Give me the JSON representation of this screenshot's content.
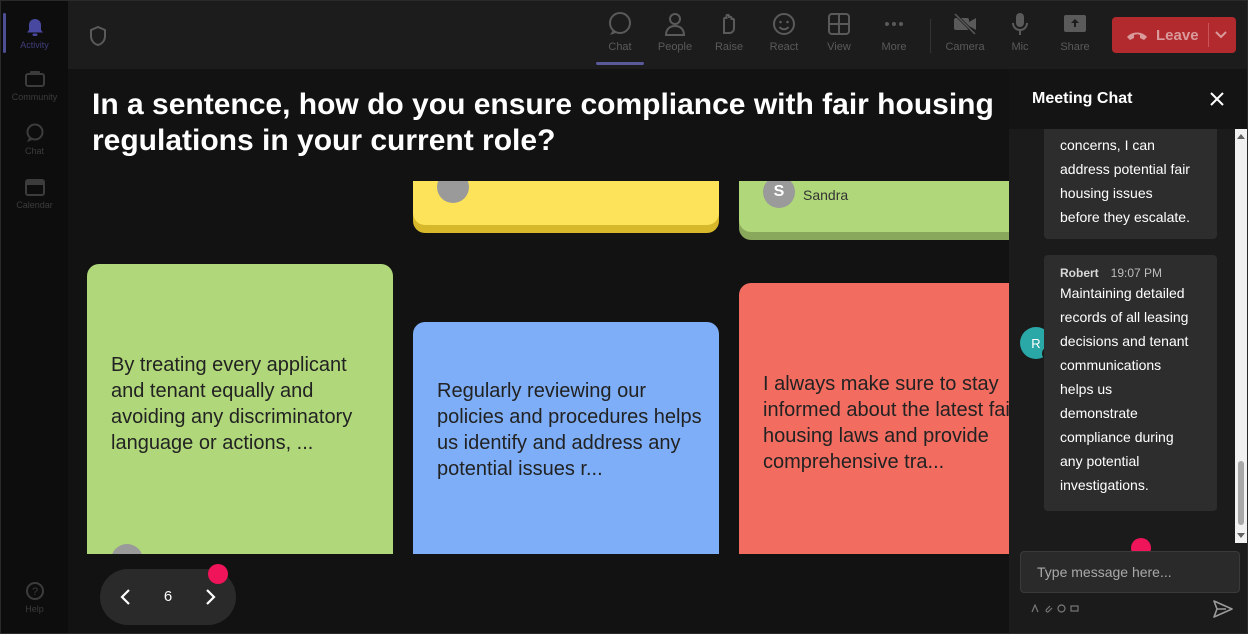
{
  "rail": {
    "items": [
      {
        "label": "Activity",
        "icon": "bell-icon"
      },
      {
        "label": "Community",
        "icon": "community-icon"
      },
      {
        "label": "Chat",
        "icon": "chat-icon"
      },
      {
        "label": "Calendar",
        "icon": "calendar-icon"
      }
    ],
    "help_label": "Help"
  },
  "toolbar": {
    "buttons": [
      {
        "label": "Chat",
        "icon": "chat-icon"
      },
      {
        "label": "People",
        "icon": "people-icon"
      },
      {
        "label": "Raise",
        "icon": "raise-hand-icon"
      },
      {
        "label": "React",
        "icon": "react-icon"
      },
      {
        "label": "View",
        "icon": "view-icon"
      },
      {
        "label": "More",
        "icon": "more-icon"
      },
      {
        "label": "Camera",
        "icon": "camera-icon"
      },
      {
        "label": "Mic",
        "icon": "mic-icon"
      },
      {
        "label": "Share",
        "icon": "share-icon"
      }
    ],
    "leave_label": "Leave",
    "leave_color": "#b32a2e"
  },
  "stage": {
    "question": "In a sentence, how do you ensure compliance with fair housing regulations in your current role?",
    "cards": [
      {
        "text": "",
        "author_initial": "",
        "color": "#fde35a"
      },
      {
        "text": "",
        "author": "Sandra",
        "author_initial": "S",
        "color": "#b0d87a"
      },
      {
        "text": "By treating every applicant and tenant equally and avoiding any discriminatory language or actions, ...",
        "color": "#b0d87a"
      },
      {
        "text": "Regularly reviewing our policies and procedures helps us identify and address any potential issues r...",
        "color": "#7daef7"
      },
      {
        "text": "I always make sure to stay informed about the latest fair housing laws and provide comprehensive tra...",
        "color": "#f26c60"
      }
    ],
    "pager": {
      "page": "6"
    }
  },
  "chat": {
    "title": "Meeting Chat",
    "messages": [
      {
        "lines": [
          "concerns, I can",
          "address potential fair",
          "housing issues",
          "before they escalate."
        ]
      },
      {
        "author": "Robert",
        "time": "19:07 PM",
        "avatar_initial": "R",
        "lines": [
          "Maintaining detailed",
          "records of all leasing",
          "decisions and tenant",
          "communications",
          "helps us",
          "demonstrate",
          "compliance during",
          "any potential",
          "investigations."
        ]
      }
    ],
    "input_placeholder": "Type message here..."
  }
}
